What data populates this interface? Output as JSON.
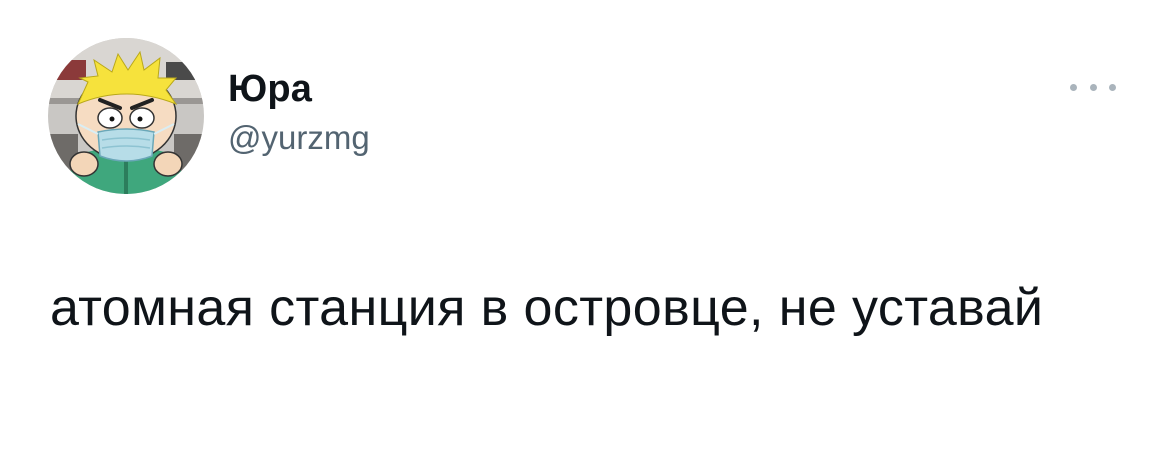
{
  "tweet": {
    "author": {
      "display_name": "Юра",
      "handle": "@yurzmg",
      "avatar_icon": "cartoon-boy-face-mask-avatar"
    },
    "more_icon": "more-options-icon",
    "text": "атомная станция в островце, не уставай"
  },
  "colors": {
    "text_primary": "#0f1419",
    "text_secondary": "#536471",
    "more_dots": "#aab4bc",
    "background": "#ffffff"
  }
}
